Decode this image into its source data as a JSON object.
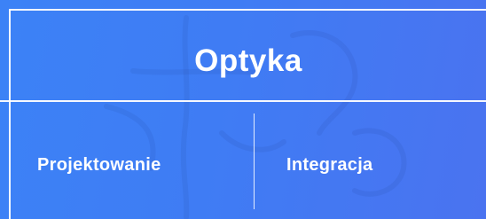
{
  "header": {
    "title": "Optyka"
  },
  "tabs": [
    {
      "label": "Projektowanie"
    },
    {
      "label": "Integracja"
    }
  ],
  "colors": {
    "background_start": "#3c82f6",
    "background_end": "#4a73f0",
    "text": "#ffffff",
    "lines": "#ffffff"
  }
}
